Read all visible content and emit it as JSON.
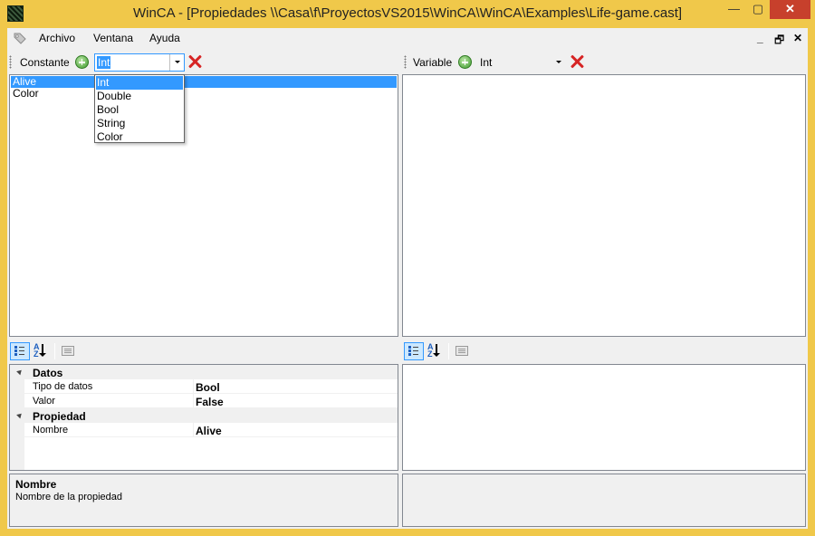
{
  "window": {
    "title": "WinCA - [Propiedades \\\\Casa\\f\\ProyectosVS2015\\WinCA\\WinCA\\Examples\\Life-game.cast]",
    "controls": {
      "minimize": "—",
      "maximize": "▢",
      "close": "✕"
    }
  },
  "menubar": {
    "items": [
      "Archivo",
      "Ventana",
      "Ayuda"
    ],
    "mdi_controls": {
      "minimize": "_",
      "restore": "🗗",
      "close": "✕"
    }
  },
  "left_pane": {
    "toolbar": {
      "label": "Constante",
      "type_value": "Int"
    },
    "dropdown_options": [
      "Int",
      "Double",
      "Bool",
      "String",
      "Color"
    ],
    "dropdown_highlighted": "Int",
    "list_items": [
      "Alive",
      "Color"
    ],
    "selected_item": "Alive",
    "property_grid": {
      "categories": [
        {
          "name": "Datos",
          "rows": [
            {
              "name": "Tipo de datos",
              "value": "Bool"
            },
            {
              "name": "Valor",
              "value": "False"
            }
          ]
        },
        {
          "name": "Propiedad",
          "rows": [
            {
              "name": "Nombre",
              "value": "Alive"
            }
          ]
        }
      ]
    },
    "help": {
      "title": "Nombre",
      "description": "Nombre de la propiedad"
    }
  },
  "right_pane": {
    "toolbar": {
      "label": "Variable",
      "type_value": "Int"
    }
  },
  "icons": {
    "app": "cellular-automaton-icon",
    "menu": "tag-icon",
    "add": "add-circle-icon",
    "delete": "delete-x-icon",
    "categorized": "categorized-view-icon",
    "alphabetical": "alphabetical-sort-icon",
    "property_pages": "property-pages-icon"
  },
  "colors": {
    "accent": "#3399ff",
    "titlebar": "#f0c84a",
    "close": "#c7402c",
    "delete": "#d62424",
    "add": "#3e9a2e"
  }
}
